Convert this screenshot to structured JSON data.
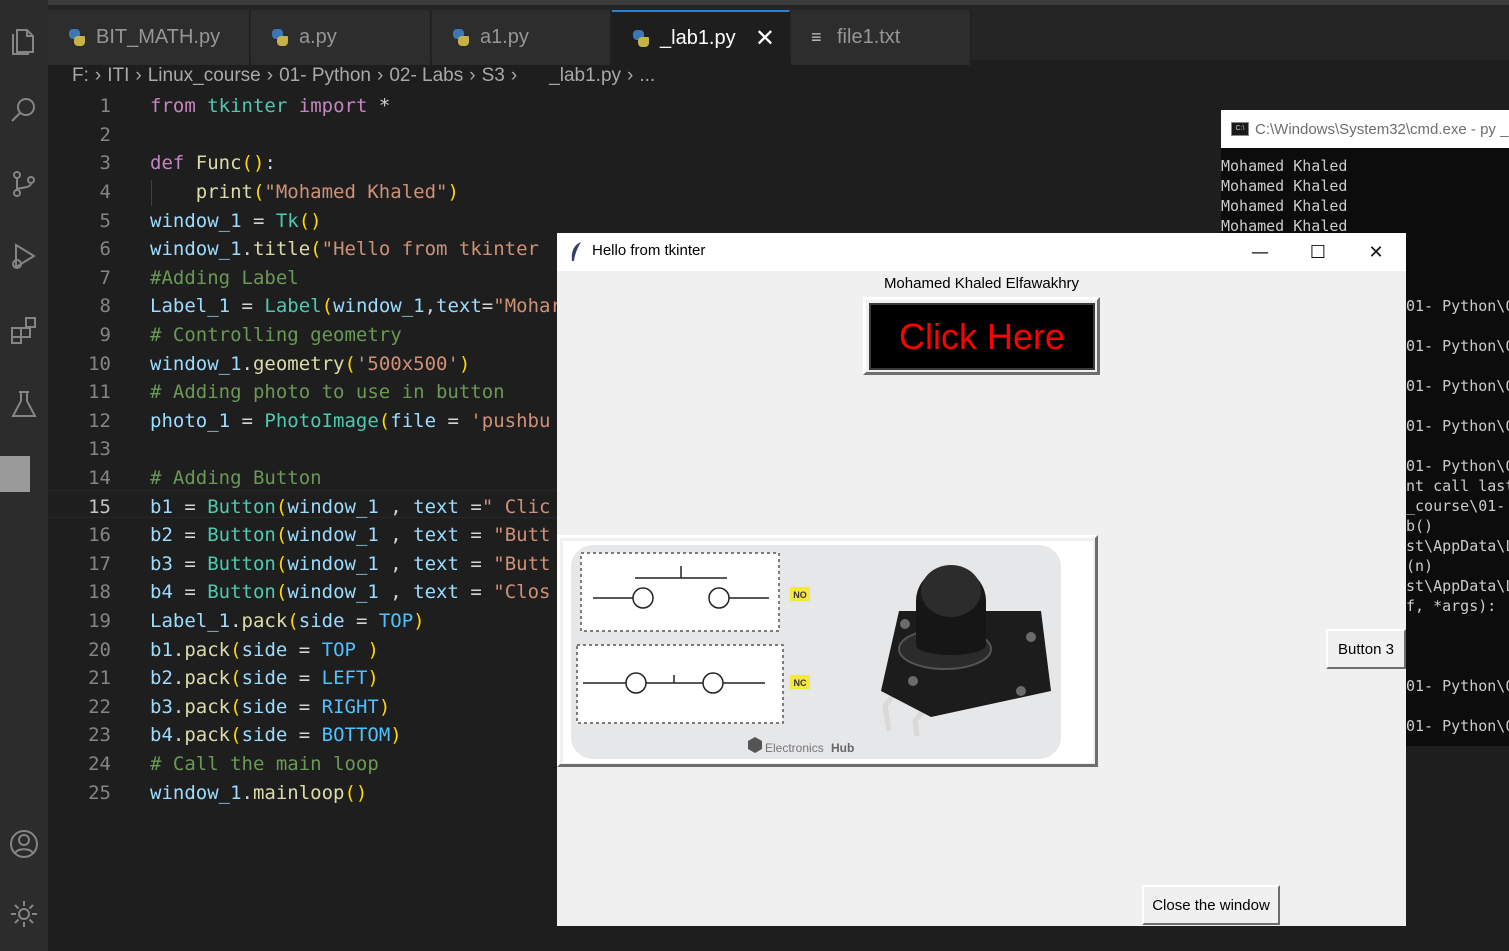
{
  "tabs": [
    {
      "label": "BIT_MATH.py",
      "icon": "python-icon"
    },
    {
      "label": "a.py",
      "icon": "python-icon"
    },
    {
      "label": "a1.py",
      "icon": "python-icon"
    },
    {
      "label": "_lab1.py",
      "icon": "python-icon",
      "active": true,
      "close": "✕"
    },
    {
      "label": "file1.txt",
      "icon": "text-file-icon"
    }
  ],
  "breadcrumb": [
    "F:",
    "ITI",
    "Linux_course",
    "01- Python",
    "02- Labs",
    "S3",
    "_lab1.py",
    "..."
  ],
  "editor": {
    "current_line": 15,
    "line_numbers": [
      "1",
      "2",
      "3",
      "4",
      "5",
      "6",
      "7",
      "8",
      "9",
      "10",
      "11",
      "12",
      "13",
      "14",
      "15",
      "16",
      "17",
      "18",
      "19",
      "20",
      "21",
      "22",
      "23",
      "24",
      "25"
    ],
    "lines": [
      [
        [
          "kw",
          "from"
        ],
        [
          "op",
          " "
        ],
        [
          "cls",
          "tkinter"
        ],
        [
          "op",
          " "
        ],
        [
          "kw",
          "import"
        ],
        [
          "op",
          " *"
        ]
      ],
      [],
      [
        [
          "kw",
          "def"
        ],
        [
          "op",
          " "
        ],
        [
          "fn",
          "Func"
        ],
        [
          "br1",
          "()"
        ],
        [
          "op",
          ":"
        ]
      ],
      [
        [
          "op",
          "    "
        ],
        [
          "fn",
          "print"
        ],
        [
          "br1",
          "("
        ],
        [
          "str",
          "\"Mohamed Khaled\""
        ],
        [
          "br1",
          ")"
        ]
      ],
      [
        [
          "var",
          "window_1"
        ],
        [
          "op",
          " = "
        ],
        [
          "cls",
          "Tk"
        ],
        [
          "br1",
          "()"
        ]
      ],
      [
        [
          "var",
          "window_1"
        ],
        [
          "op",
          "."
        ],
        [
          "fn",
          "title"
        ],
        [
          "br1",
          "("
        ],
        [
          "str",
          "\"Hello from tkinter"
        ]
      ],
      [
        [
          "cmt",
          "#Adding Label"
        ]
      ],
      [
        [
          "var",
          "Label_1"
        ],
        [
          "op",
          " = "
        ],
        [
          "cls",
          "Label"
        ],
        [
          "br1",
          "("
        ],
        [
          "var",
          "window_1"
        ],
        [
          "op",
          ","
        ],
        [
          "var",
          "text"
        ],
        [
          "op",
          "="
        ],
        [
          "str",
          "\"Mohar"
        ]
      ],
      [
        [
          "cmt",
          "# Controlling geometry"
        ]
      ],
      [
        [
          "var",
          "window_1"
        ],
        [
          "op",
          "."
        ],
        [
          "fn",
          "geometry"
        ],
        [
          "br1",
          "("
        ],
        [
          "str",
          "'500x500'"
        ],
        [
          "br1",
          ")"
        ]
      ],
      [
        [
          "cmt",
          "# Adding photo to use in button"
        ]
      ],
      [
        [
          "var",
          "photo_1"
        ],
        [
          "op",
          " = "
        ],
        [
          "cls",
          "PhotoImage"
        ],
        [
          "br1",
          "("
        ],
        [
          "var",
          "file"
        ],
        [
          "op",
          " = "
        ],
        [
          "str",
          "'pushbu"
        ]
      ],
      [],
      [
        [
          "cmt",
          "# Adding Button"
        ]
      ],
      [
        [
          "var",
          "b1"
        ],
        [
          "op",
          " = "
        ],
        [
          "cls",
          "Button"
        ],
        [
          "br1",
          "("
        ],
        [
          "var",
          "window_1"
        ],
        [
          "op",
          " , "
        ],
        [
          "var",
          "text"
        ],
        [
          "op",
          " ="
        ],
        [
          "str",
          "\" Clic"
        ]
      ],
      [
        [
          "var",
          "b2"
        ],
        [
          "op",
          " = "
        ],
        [
          "cls",
          "Button"
        ],
        [
          "br1",
          "("
        ],
        [
          "var",
          "window_1"
        ],
        [
          "op",
          " , "
        ],
        [
          "var",
          "text"
        ],
        [
          "op",
          " = "
        ],
        [
          "str",
          "\"Butt"
        ]
      ],
      [
        [
          "var",
          "b3"
        ],
        [
          "op",
          " = "
        ],
        [
          "cls",
          "Button"
        ],
        [
          "br1",
          "("
        ],
        [
          "var",
          "window_1"
        ],
        [
          "op",
          " , "
        ],
        [
          "var",
          "text"
        ],
        [
          "op",
          " = "
        ],
        [
          "str",
          "\"Butt"
        ]
      ],
      [
        [
          "var",
          "b4"
        ],
        [
          "op",
          " = "
        ],
        [
          "cls",
          "Button"
        ],
        [
          "br1",
          "("
        ],
        [
          "var",
          "window_1"
        ],
        [
          "op",
          " , "
        ],
        [
          "var",
          "text"
        ],
        [
          "op",
          " = "
        ],
        [
          "str",
          "\"Clos"
        ]
      ],
      [
        [
          "var",
          "Label_1"
        ],
        [
          "op",
          "."
        ],
        [
          "fn",
          "pack"
        ],
        [
          "br1",
          "("
        ],
        [
          "var",
          "side"
        ],
        [
          "op",
          " = "
        ],
        [
          "const",
          "TOP"
        ],
        [
          "br1",
          ")"
        ]
      ],
      [
        [
          "var",
          "b1"
        ],
        [
          "op",
          "."
        ],
        [
          "fn",
          "pack"
        ],
        [
          "br1",
          "("
        ],
        [
          "var",
          "side"
        ],
        [
          "op",
          " = "
        ],
        [
          "const",
          "TOP"
        ],
        [
          "op",
          " "
        ],
        [
          "br1",
          ")"
        ]
      ],
      [
        [
          "var",
          "b2"
        ],
        [
          "op",
          "."
        ],
        [
          "fn",
          "pack"
        ],
        [
          "br1",
          "("
        ],
        [
          "var",
          "side"
        ],
        [
          "op",
          " = "
        ],
        [
          "const",
          "LEFT"
        ],
        [
          "br1",
          ")"
        ]
      ],
      [
        [
          "var",
          "b3"
        ],
        [
          "op",
          "."
        ],
        [
          "fn",
          "pack"
        ],
        [
          "br1",
          "("
        ],
        [
          "var",
          "side"
        ],
        [
          "op",
          " = "
        ],
        [
          "const",
          "RIGHT"
        ],
        [
          "br1",
          ")"
        ]
      ],
      [
        [
          "var",
          "b4"
        ],
        [
          "op",
          "."
        ],
        [
          "fn",
          "pack"
        ],
        [
          "br1",
          "("
        ],
        [
          "var",
          "side"
        ],
        [
          "op",
          " = "
        ],
        [
          "const",
          "BOTTOM"
        ],
        [
          "br1",
          ")"
        ]
      ],
      [
        [
          "cmt",
          "# Call the main loop"
        ]
      ],
      [
        [
          "var",
          "window_1"
        ],
        [
          "op",
          "."
        ],
        [
          "fn",
          "mainloop"
        ],
        [
          "br1",
          "()"
        ]
      ]
    ]
  },
  "cmd": {
    "title": "C:\\Windows\\System32\\cmd.exe - py  _",
    "lines": [
      "Mohamed Khaled",
      "Mohamed Khaled",
      "Mohamed Khaled",
      "Mohamed Khaled",
      "01- Python\\0",
      "01- Python\\0",
      "01- Python\\0",
      "01- Python\\0",
      "01- Python\\0",
      "nt call last",
      "_course\\01-",
      "b()",
      "st\\AppData\\L",
      "(n)",
      "st\\AppData\\L",
      "f, *args):",
      "01- Python\\0",
      "01- Python\\0"
    ]
  },
  "tk": {
    "title": "Hello from tkinter",
    "label": "Mohamed Khaled Elfawakhry",
    "click_button": "Click Here",
    "click_button_color": "#ff0000",
    "image_labels": {
      "no": "NO",
      "nc": "NC",
      "brand": "Electronics",
      "brand_bold": "Hub"
    },
    "button3": "Button 3",
    "close_button": "Close the window"
  }
}
